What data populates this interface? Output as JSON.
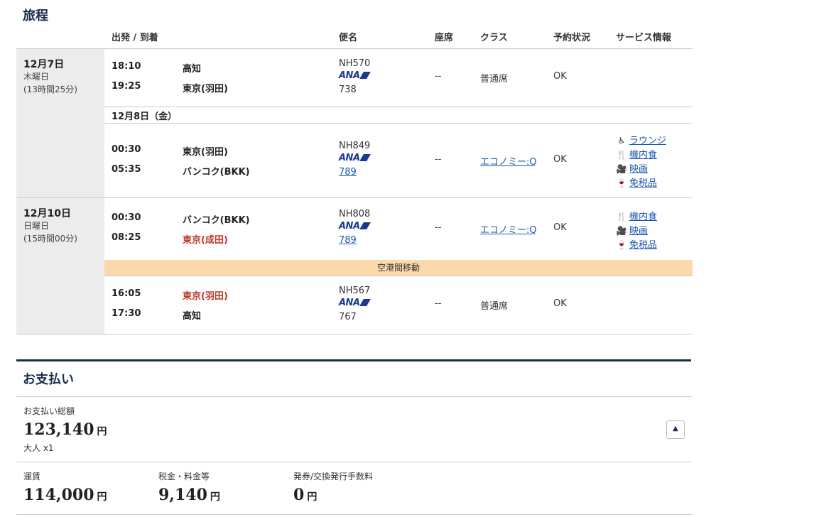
{
  "itinerary": {
    "title": "旅程",
    "headers": {
      "dep_arr": "出発 / 到着",
      "flight": "便名",
      "seat": "座席",
      "class": "クラス",
      "status": "予約状況",
      "service": "サービス情報"
    },
    "day1": {
      "date": "12月7日",
      "weekday": "木曜日",
      "duration": "(13時間25分)"
    },
    "seg1": {
      "dep_time": "18:10",
      "dep_city": "高知",
      "arr_time": "19:25",
      "arr_city": "東京(羽田)",
      "flight_no": "NH570",
      "aircraft": "738",
      "seat": "--",
      "cls": "普通席",
      "status": "OK"
    },
    "subdate": "12月8日（金）",
    "seg2": {
      "dep_time": "00:30",
      "dep_city": "東京(羽田)",
      "arr_time": "05:35",
      "arr_city": "バンコク(BKK)",
      "flight_no": "NH849",
      "aircraft": "789",
      "seat": "--",
      "cls": "エコノミー:Q",
      "status": "OK",
      "services": [
        "ラウンジ",
        "機内食",
        "映画",
        "免税品"
      ]
    },
    "day2": {
      "date": "12月10日",
      "weekday": "日曜日",
      "duration": "(15時間00分)"
    },
    "seg3": {
      "dep_time": "00:30",
      "dep_city": "バンコク(BKK)",
      "arr_time": "08:25",
      "arr_city": "東京(成田)",
      "flight_no": "NH808",
      "aircraft": "789",
      "seat": "--",
      "cls": "エコノミー:Q",
      "status": "OK",
      "services": [
        "機内食",
        "映画",
        "免税品"
      ]
    },
    "transfer": "空港間移動",
    "seg4": {
      "dep_time": "16:05",
      "dep_city": "東京(羽田)",
      "arr_time": "17:30",
      "arr_city": "高知",
      "flight_no": "NH567",
      "aircraft": "767",
      "seat": "--",
      "cls": "普通席",
      "status": "OK"
    },
    "airline_logo": "ANA"
  },
  "payment": {
    "title": "お支払い",
    "total_label": "お支払い総額",
    "total_amount": "123,140",
    "yen": "円",
    "passengers": "大人 x1",
    "fare_label": "運賃",
    "fare_amount": "114,000",
    "tax_label": "税金・料金等",
    "tax_amount": "9,140",
    "fee_label": "発券/交換発行手数料",
    "fee_amount": "0",
    "toggle_icon": "▲"
  },
  "colors": {
    "navy": "#1a2b4c",
    "link": "#1a56b0",
    "highlight": "#c0392b",
    "transfer_bg": "#fcd9ad",
    "grey_bg": "#ececec"
  }
}
